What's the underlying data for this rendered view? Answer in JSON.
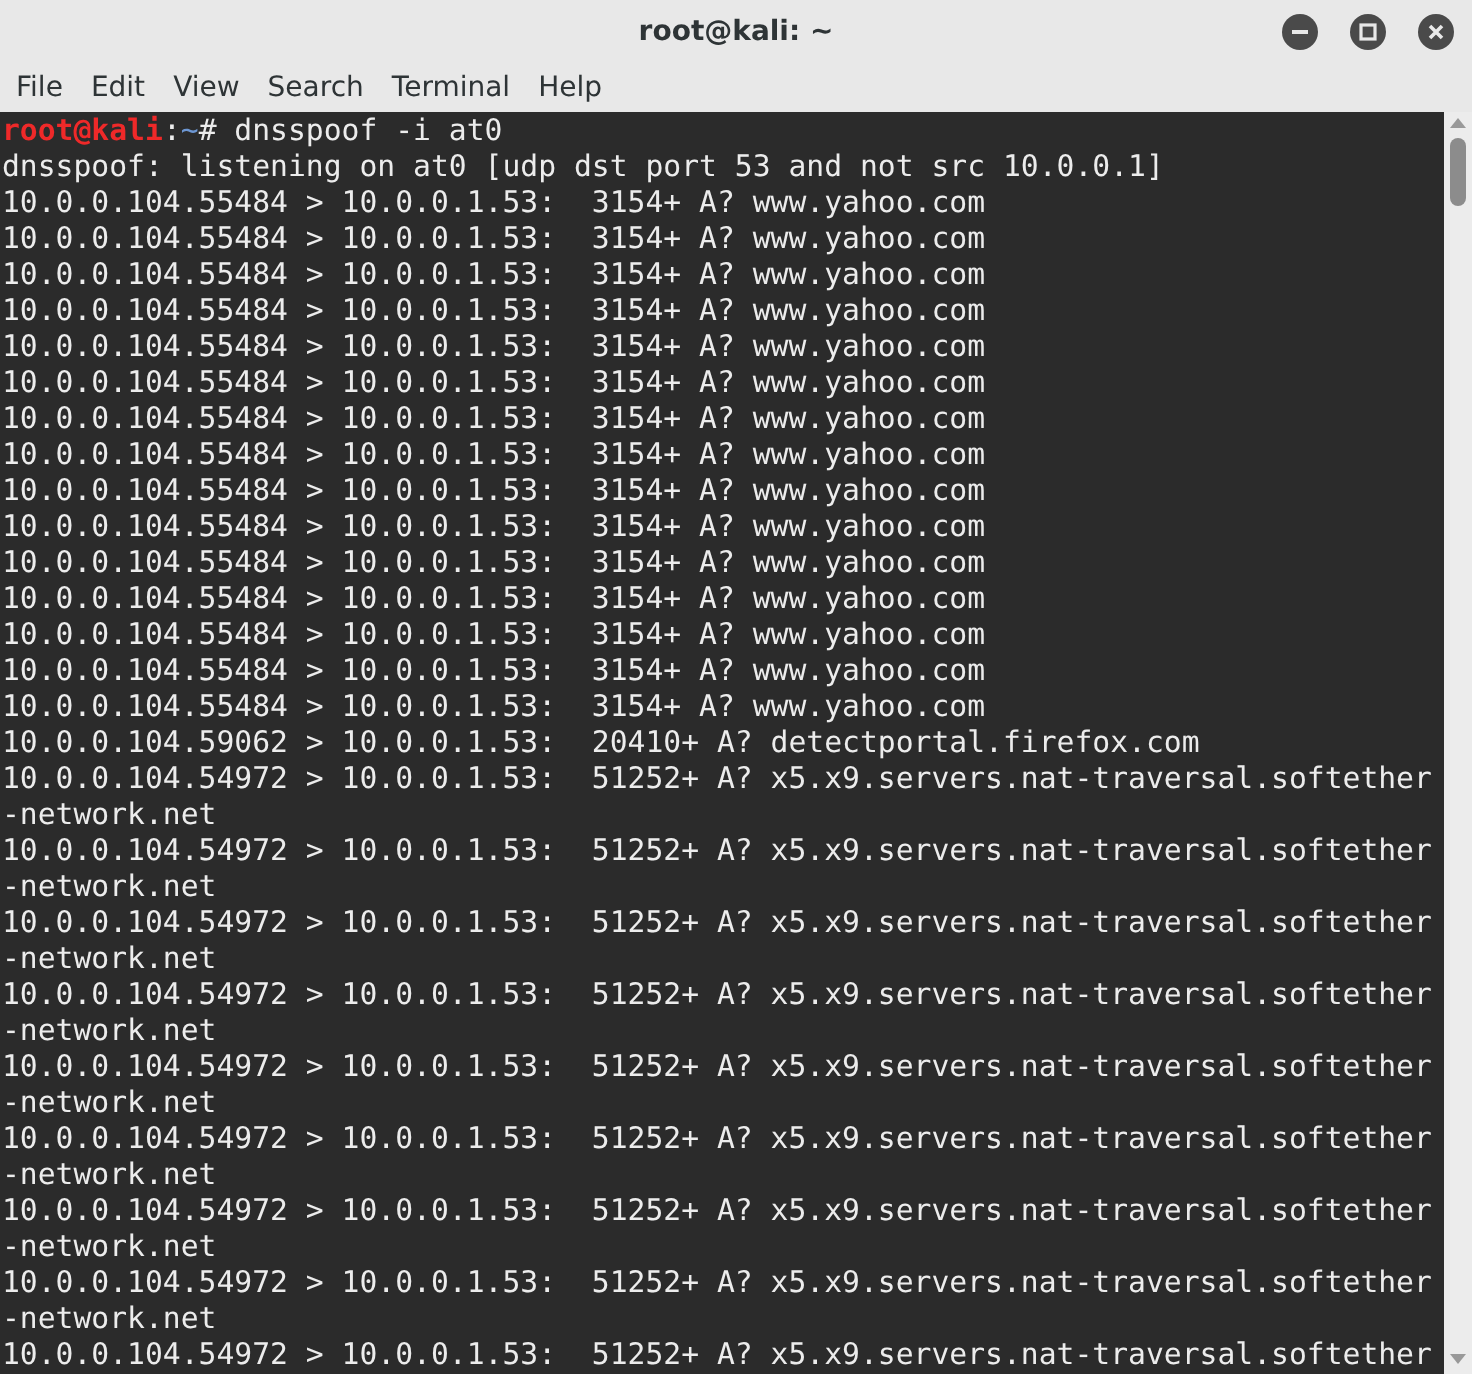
{
  "window": {
    "title": "root@kali: ~"
  },
  "menu": [
    "File",
    "Edit",
    "View",
    "Search",
    "Terminal",
    "Help"
  ],
  "terminal": {
    "prompt": {
      "user_host": "root@kali",
      "separator": ":",
      "path": "~",
      "symbol": "#",
      "command": " dnsspoof -i at0"
    },
    "lines": [
      "dnsspoof: listening on at0 [udp dst port 53 and not src 10.0.0.1]",
      "10.0.0.104.55484 > 10.0.0.1.53:  3154+ A? www.yahoo.com",
      "10.0.0.104.55484 > 10.0.0.1.53:  3154+ A? www.yahoo.com",
      "10.0.0.104.55484 > 10.0.0.1.53:  3154+ A? www.yahoo.com",
      "10.0.0.104.55484 > 10.0.0.1.53:  3154+ A? www.yahoo.com",
      "10.0.0.104.55484 > 10.0.0.1.53:  3154+ A? www.yahoo.com",
      "10.0.0.104.55484 > 10.0.0.1.53:  3154+ A? www.yahoo.com",
      "10.0.0.104.55484 > 10.0.0.1.53:  3154+ A? www.yahoo.com",
      "10.0.0.104.55484 > 10.0.0.1.53:  3154+ A? www.yahoo.com",
      "10.0.0.104.55484 > 10.0.0.1.53:  3154+ A? www.yahoo.com",
      "10.0.0.104.55484 > 10.0.0.1.53:  3154+ A? www.yahoo.com",
      "10.0.0.104.55484 > 10.0.0.1.53:  3154+ A? www.yahoo.com",
      "10.0.0.104.55484 > 10.0.0.1.53:  3154+ A? www.yahoo.com",
      "10.0.0.104.55484 > 10.0.0.1.53:  3154+ A? www.yahoo.com",
      "10.0.0.104.55484 > 10.0.0.1.53:  3154+ A? www.yahoo.com",
      "10.0.0.104.55484 > 10.0.0.1.53:  3154+ A? www.yahoo.com",
      "10.0.0.104.59062 > 10.0.0.1.53:  20410+ A? detectportal.firefox.com",
      "10.0.0.104.54972 > 10.0.0.1.53:  51252+ A? x5.x9.servers.nat-traversal.softether",
      "-network.net",
      "10.0.0.104.54972 > 10.0.0.1.53:  51252+ A? x5.x9.servers.nat-traversal.softether",
      "-network.net",
      "10.0.0.104.54972 > 10.0.0.1.53:  51252+ A? x5.x9.servers.nat-traversal.softether",
      "-network.net",
      "10.0.0.104.54972 > 10.0.0.1.53:  51252+ A? x5.x9.servers.nat-traversal.softether",
      "-network.net",
      "10.0.0.104.54972 > 10.0.0.1.53:  51252+ A? x5.x9.servers.nat-traversal.softether",
      "-network.net",
      "10.0.0.104.54972 > 10.0.0.1.53:  51252+ A? x5.x9.servers.nat-traversal.softether",
      "-network.net",
      "10.0.0.104.54972 > 10.0.0.1.53:  51252+ A? x5.x9.servers.nat-traversal.softether",
      "-network.net",
      "10.0.0.104.54972 > 10.0.0.1.53:  51252+ A? x5.x9.servers.nat-traversal.softether",
      "-network.net",
      "10.0.0.104.54972 > 10.0.0.1.53:  51252+ A? x5.x9.servers.nat-traversal.softether"
    ]
  }
}
